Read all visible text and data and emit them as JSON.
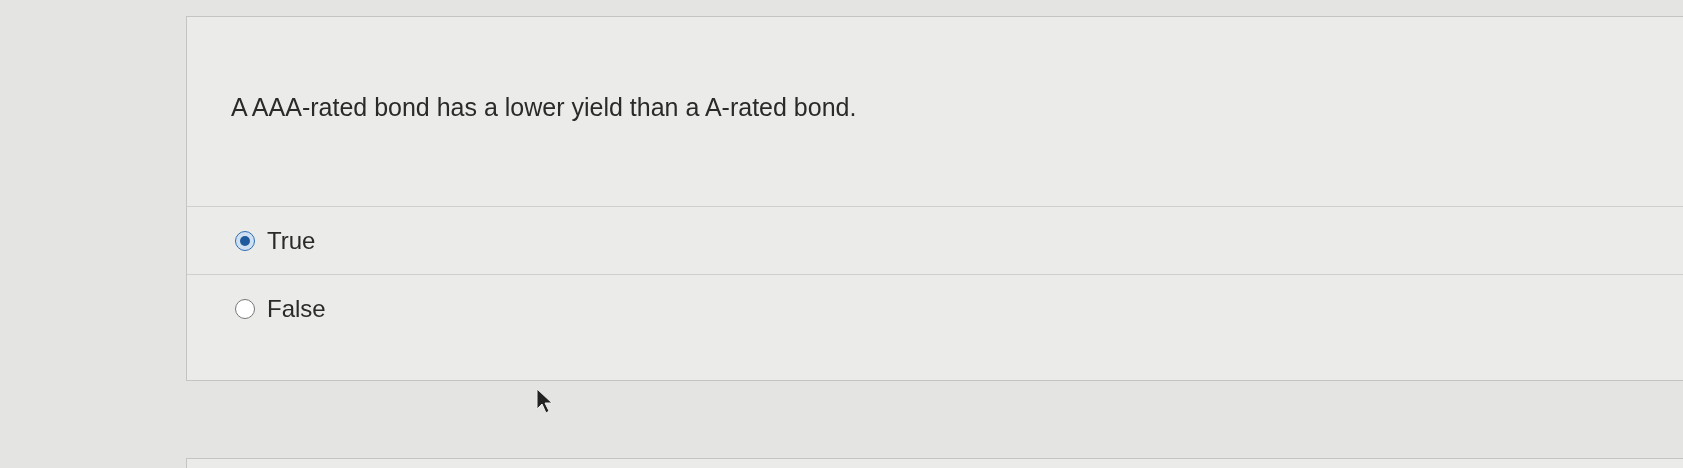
{
  "question": {
    "text": "A AAA-rated bond has a lower yield than a A-rated bond.",
    "options": [
      {
        "label": "True",
        "selected": true
      },
      {
        "label": "False",
        "selected": false
      }
    ]
  }
}
